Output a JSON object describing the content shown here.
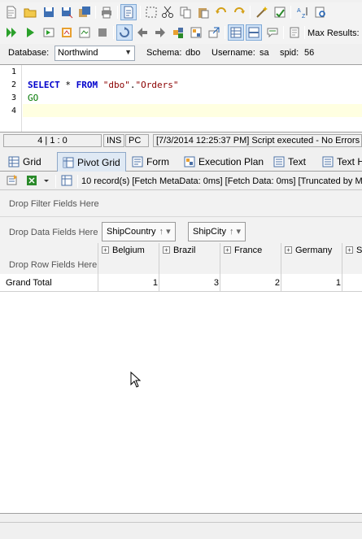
{
  "toolbar": {
    "max_results_label": "Max Results:"
  },
  "connection": {
    "database_label": "Database:",
    "database_value": "Northwind",
    "schema_label": "Schema:",
    "schema_value": "dbo",
    "username_label": "Username:",
    "username_value": "sa",
    "spid_label": "spid:",
    "spid_value": "56"
  },
  "editor": {
    "line_numbers": [
      "1",
      "2",
      "3",
      "4"
    ],
    "line2": {
      "select": "SELECT",
      "star": " * ",
      "from": "FROM",
      "space": " ",
      "schema": "\"dbo\"",
      "dot": ".",
      "table": "\"Orders\""
    },
    "line3": "GO"
  },
  "status": {
    "position": "4 | 1 : 0",
    "ins": "INS",
    "pc": "PC",
    "message": "[7/3/2014 12:25:37 PM] Script executed - No Errors"
  },
  "tabs": [
    {
      "label": "Grid"
    },
    {
      "label": "Pivot Grid"
    },
    {
      "label": "Form"
    },
    {
      "label": "Execution Plan"
    },
    {
      "label": "Text"
    },
    {
      "label": "Text H"
    }
  ],
  "results": {
    "info": "10 record(s) [Fetch MetaData: 0ms] [Fetch Data: 0ms]  [Truncated by M"
  },
  "pivot": {
    "filter_zone": "Drop Filter Fields Here",
    "data_zone": "Drop Data Fields Here",
    "row_zone": "Drop Row Fields Here",
    "fields": [
      {
        "label": "ShipCountry",
        "arrow": "↑ ▾"
      },
      {
        "label": "ShipCity",
        "arrow": "↑ ▾"
      }
    ],
    "columns": [
      {
        "label": "Belgium",
        "value": "1"
      },
      {
        "label": "Brazil",
        "value": "3"
      },
      {
        "label": "France",
        "value": "2"
      },
      {
        "label": "Germany",
        "value": "1"
      },
      {
        "label": "S",
        "value": ""
      }
    ],
    "grand_total_label": "Grand Total"
  }
}
